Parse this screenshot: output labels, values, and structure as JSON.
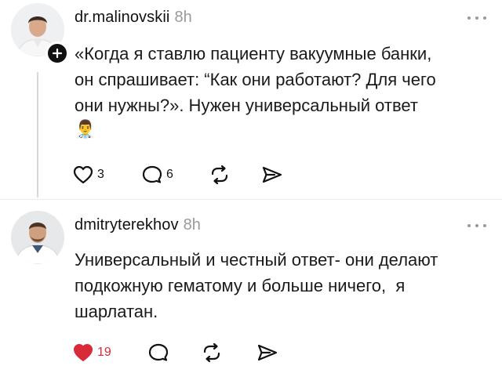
{
  "posts": [
    {
      "username": "dr.malinovskii",
      "time": "8h",
      "text": "«Когда я ставлю пациенту вакуумные банки,\nон спрашивает: “Как они работают? Для чего\nони нужны?». Нужен универсальный ответ",
      "emoji": "👨‍⚕️",
      "likes": "3",
      "replies": "6",
      "liked": false
    },
    {
      "username": "dmitryterekhov",
      "time": "8h",
      "text": "Универсальный и честный ответ- они делают\nподкожную гематому и больше ничего,  я\nшарлатан.",
      "likes": "19",
      "replies": "",
      "liked": true
    }
  ],
  "icons": {
    "like": "heart-icon",
    "reply": "comment-icon",
    "repost": "repost-icon",
    "share": "send-icon",
    "more": "more-icon",
    "follow": "plus-icon"
  },
  "colors": {
    "liked": "#d92a3a",
    "time": "#9a9a9a",
    "thread_line": "#d6d6d6"
  }
}
